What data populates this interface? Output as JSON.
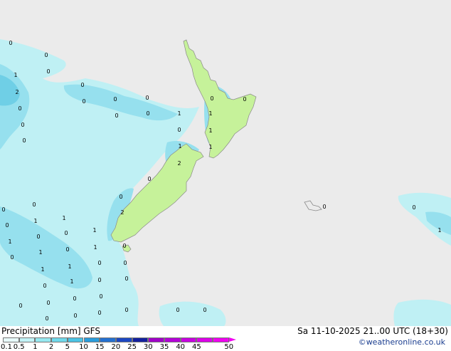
{
  "legend": {
    "title": "Precipitation [mm] GFS",
    "valid_time": "Sa 11-10-2025 21..00 UTC (18+30)",
    "credit": "©weatheronline.co.uk",
    "scale_labels": [
      "0.1",
      "0.5",
      "1",
      "2",
      "5",
      "10",
      "15",
      "20",
      "25",
      "30",
      "35",
      "40",
      "45",
      "50"
    ],
    "scale_colors": [
      "#e8fbfb",
      "#c2f3f7",
      "#96e8f0",
      "#6fd8ea",
      "#4bc3e4",
      "#2a9ddc",
      "#2470d0",
      "#1c47c2",
      "#13219f",
      "#a000c8",
      "#b400d8",
      "#c800e0",
      "#dc00e8",
      "#f000f0"
    ]
  },
  "map": {
    "ocean_color": "#ebebeb",
    "land_color": "#c6f29a",
    "rain_colors": {
      "light": "#bff0f4",
      "moderate": "#96e0ee",
      "heavy": "#6fcfe6"
    },
    "amount_labels": [
      {
        "text": "0"
      },
      {
        "text": "0"
      },
      {
        "text": "1"
      },
      {
        "text": "0"
      },
      {
        "text": "2"
      },
      {
        "text": "0"
      },
      {
        "text": "0"
      },
      {
        "text": "0"
      },
      {
        "text": "0"
      },
      {
        "text": "0"
      },
      {
        "text": "1"
      },
      {
        "text": "0"
      },
      {
        "text": "0"
      },
      {
        "text": "0"
      },
      {
        "text": "1"
      },
      {
        "text": "0"
      },
      {
        "text": "0"
      },
      {
        "text": "1"
      },
      {
        "text": "0"
      },
      {
        "text": "1"
      },
      {
        "text": "0"
      },
      {
        "text": "1"
      },
      {
        "text": "2"
      },
      {
        "text": "0"
      },
      {
        "text": "0"
      },
      {
        "text": "0"
      },
      {
        "text": "2"
      },
      {
        "text": "0"
      },
      {
        "text": "1"
      },
      {
        "text": "1"
      },
      {
        "text": "0"
      },
      {
        "text": "0"
      },
      {
        "text": "1"
      },
      {
        "text": "0"
      },
      {
        "text": "1"
      },
      {
        "text": "0"
      },
      {
        "text": "1"
      },
      {
        "text": "0"
      },
      {
        "text": "0"
      },
      {
        "text": "1"
      },
      {
        "text": "1"
      },
      {
        "text": "0"
      },
      {
        "text": "1"
      },
      {
        "text": "0"
      },
      {
        "text": "0"
      },
      {
        "text": "1"
      },
      {
        "text": "0"
      },
      {
        "text": "0"
      },
      {
        "text": "0"
      },
      {
        "text": "0"
      },
      {
        "text": "0"
      },
      {
        "text": "0"
      },
      {
        "text": "0"
      },
      {
        "text": "0"
      },
      {
        "text": "0"
      },
      {
        "text": "0"
      },
      {
        "text": "0"
      },
      {
        "text": "0"
      },
      {
        "text": "1"
      },
      {
        "text": "0"
      },
      {
        "text": "0"
      }
    ]
  }
}
